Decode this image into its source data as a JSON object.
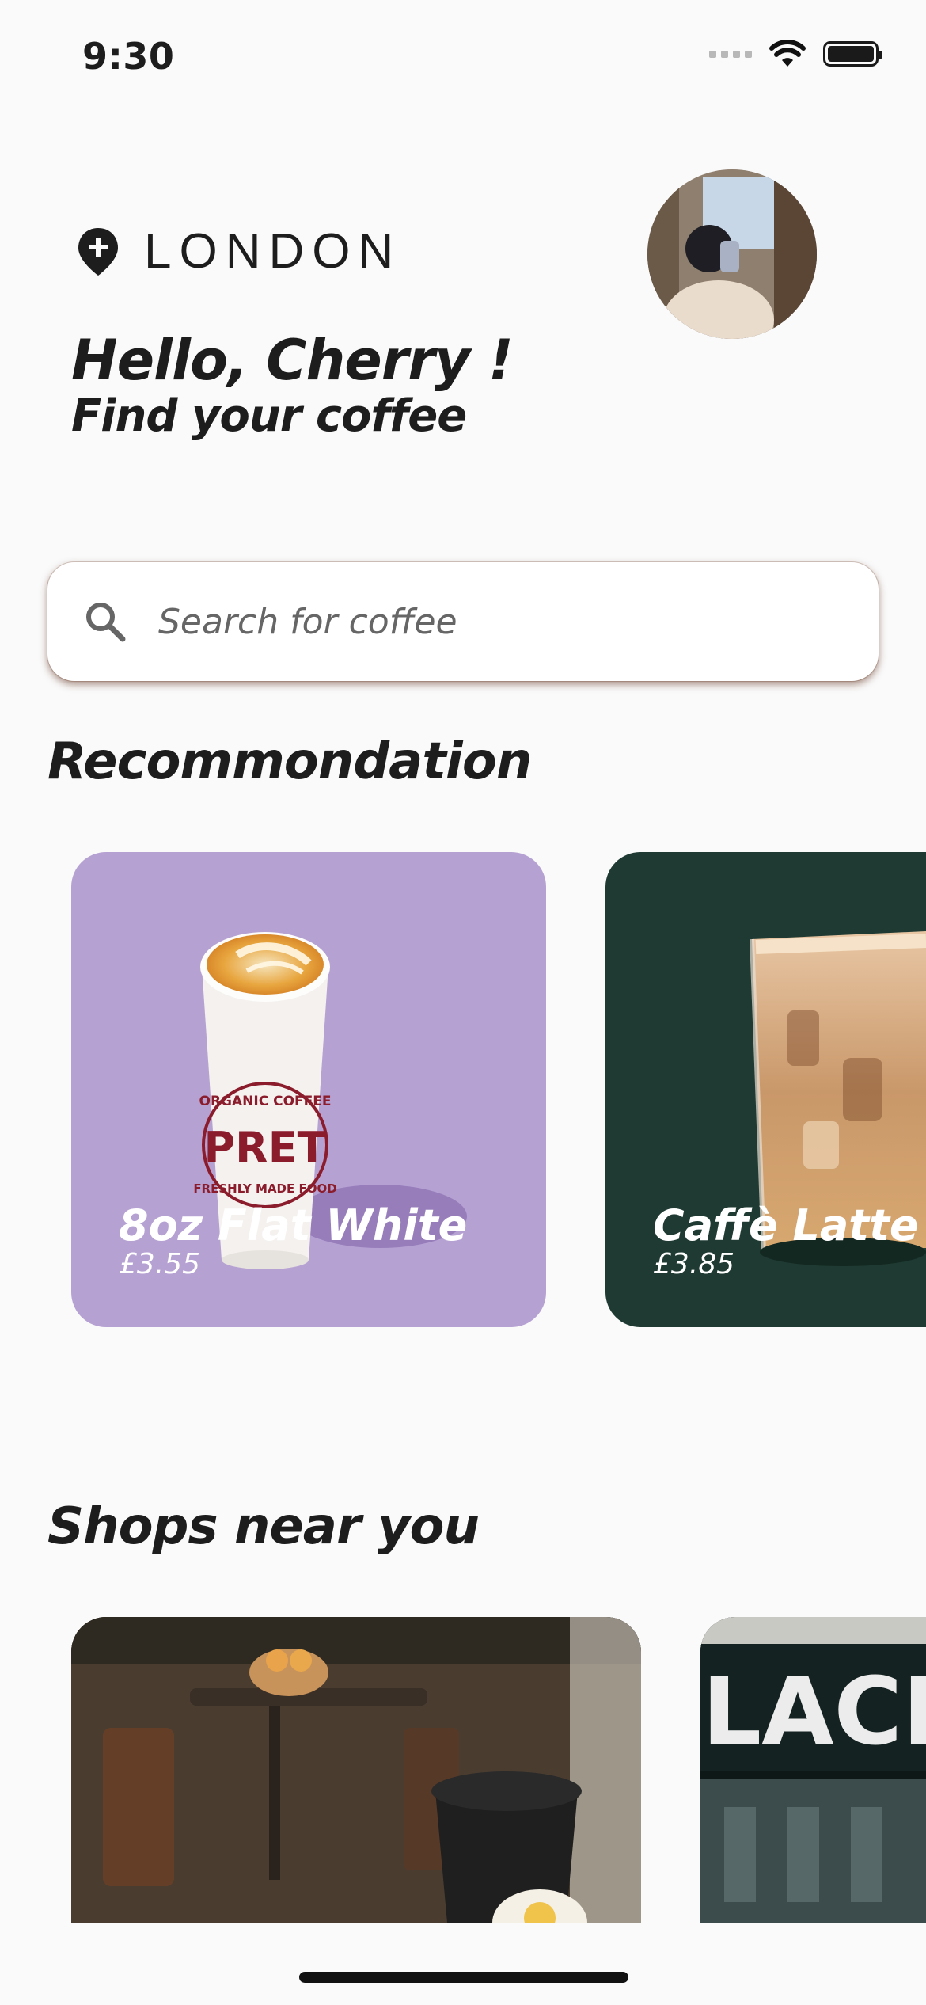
{
  "status_bar": {
    "time": "9:30"
  },
  "header": {
    "location": "LONDON",
    "greeting": "Hello, Cherry !",
    "subtitle": "Find your coffee"
  },
  "search": {
    "placeholder": "Search for coffee"
  },
  "recommendation": {
    "title": "Recommondation",
    "items": [
      {
        "name": "8oz Flat White",
        "price": "£3.55",
        "cup_text_top": "ORGANIC COFFEE",
        "cup_brand": "PRET",
        "cup_text_bottom": "FRESHLY MADE FOOD"
      },
      {
        "name": "Caffè Latte",
        "price": "£3.85"
      }
    ]
  },
  "shops": {
    "title": "Shops near you",
    "items": [
      {
        "sign_text": ""
      },
      {
        "sign_text": "LACK SI"
      }
    ]
  },
  "colors": {
    "background": "#fafafa",
    "card_purple": "#b6a1d3",
    "card_green": "#1e3a32",
    "search_shadow": "#5a2814"
  }
}
